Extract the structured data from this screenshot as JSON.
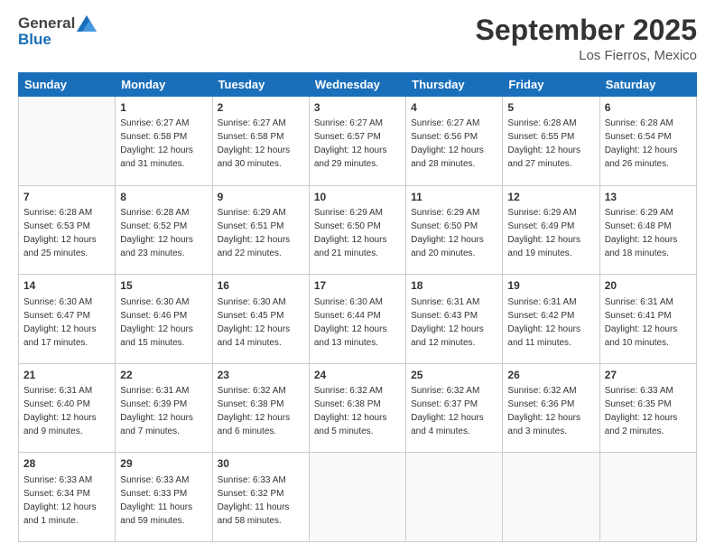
{
  "header": {
    "logo": {
      "general": "General",
      "blue": "Blue"
    },
    "title": "September 2025",
    "location": "Los Fierros, Mexico"
  },
  "calendar": {
    "days": [
      "Sunday",
      "Monday",
      "Tuesday",
      "Wednesday",
      "Thursday",
      "Friday",
      "Saturday"
    ],
    "rows": [
      [
        {
          "day": "",
          "info": ""
        },
        {
          "day": "1",
          "info": "Sunrise: 6:27 AM\nSunset: 6:58 PM\nDaylight: 12 hours\nand 31 minutes."
        },
        {
          "day": "2",
          "info": "Sunrise: 6:27 AM\nSunset: 6:58 PM\nDaylight: 12 hours\nand 30 minutes."
        },
        {
          "day": "3",
          "info": "Sunrise: 6:27 AM\nSunset: 6:57 PM\nDaylight: 12 hours\nand 29 minutes."
        },
        {
          "day": "4",
          "info": "Sunrise: 6:27 AM\nSunset: 6:56 PM\nDaylight: 12 hours\nand 28 minutes."
        },
        {
          "day": "5",
          "info": "Sunrise: 6:28 AM\nSunset: 6:55 PM\nDaylight: 12 hours\nand 27 minutes."
        },
        {
          "day": "6",
          "info": "Sunrise: 6:28 AM\nSunset: 6:54 PM\nDaylight: 12 hours\nand 26 minutes."
        }
      ],
      [
        {
          "day": "7",
          "info": "Sunrise: 6:28 AM\nSunset: 6:53 PM\nDaylight: 12 hours\nand 25 minutes."
        },
        {
          "day": "8",
          "info": "Sunrise: 6:28 AM\nSunset: 6:52 PM\nDaylight: 12 hours\nand 23 minutes."
        },
        {
          "day": "9",
          "info": "Sunrise: 6:29 AM\nSunset: 6:51 PM\nDaylight: 12 hours\nand 22 minutes."
        },
        {
          "day": "10",
          "info": "Sunrise: 6:29 AM\nSunset: 6:50 PM\nDaylight: 12 hours\nand 21 minutes."
        },
        {
          "day": "11",
          "info": "Sunrise: 6:29 AM\nSunset: 6:50 PM\nDaylight: 12 hours\nand 20 minutes."
        },
        {
          "day": "12",
          "info": "Sunrise: 6:29 AM\nSunset: 6:49 PM\nDaylight: 12 hours\nand 19 minutes."
        },
        {
          "day": "13",
          "info": "Sunrise: 6:29 AM\nSunset: 6:48 PM\nDaylight: 12 hours\nand 18 minutes."
        }
      ],
      [
        {
          "day": "14",
          "info": "Sunrise: 6:30 AM\nSunset: 6:47 PM\nDaylight: 12 hours\nand 17 minutes."
        },
        {
          "day": "15",
          "info": "Sunrise: 6:30 AM\nSunset: 6:46 PM\nDaylight: 12 hours\nand 15 minutes."
        },
        {
          "day": "16",
          "info": "Sunrise: 6:30 AM\nSunset: 6:45 PM\nDaylight: 12 hours\nand 14 minutes."
        },
        {
          "day": "17",
          "info": "Sunrise: 6:30 AM\nSunset: 6:44 PM\nDaylight: 12 hours\nand 13 minutes."
        },
        {
          "day": "18",
          "info": "Sunrise: 6:31 AM\nSunset: 6:43 PM\nDaylight: 12 hours\nand 12 minutes."
        },
        {
          "day": "19",
          "info": "Sunrise: 6:31 AM\nSunset: 6:42 PM\nDaylight: 12 hours\nand 11 minutes."
        },
        {
          "day": "20",
          "info": "Sunrise: 6:31 AM\nSunset: 6:41 PM\nDaylight: 12 hours\nand 10 minutes."
        }
      ],
      [
        {
          "day": "21",
          "info": "Sunrise: 6:31 AM\nSunset: 6:40 PM\nDaylight: 12 hours\nand 9 minutes."
        },
        {
          "day": "22",
          "info": "Sunrise: 6:31 AM\nSunset: 6:39 PM\nDaylight: 12 hours\nand 7 minutes."
        },
        {
          "day": "23",
          "info": "Sunrise: 6:32 AM\nSunset: 6:38 PM\nDaylight: 12 hours\nand 6 minutes."
        },
        {
          "day": "24",
          "info": "Sunrise: 6:32 AM\nSunset: 6:38 PM\nDaylight: 12 hours\nand 5 minutes."
        },
        {
          "day": "25",
          "info": "Sunrise: 6:32 AM\nSunset: 6:37 PM\nDaylight: 12 hours\nand 4 minutes."
        },
        {
          "day": "26",
          "info": "Sunrise: 6:32 AM\nSunset: 6:36 PM\nDaylight: 12 hours\nand 3 minutes."
        },
        {
          "day": "27",
          "info": "Sunrise: 6:33 AM\nSunset: 6:35 PM\nDaylight: 12 hours\nand 2 minutes."
        }
      ],
      [
        {
          "day": "28",
          "info": "Sunrise: 6:33 AM\nSunset: 6:34 PM\nDaylight: 12 hours\nand 1 minute."
        },
        {
          "day": "29",
          "info": "Sunrise: 6:33 AM\nSunset: 6:33 PM\nDaylight: 11 hours\nand 59 minutes."
        },
        {
          "day": "30",
          "info": "Sunrise: 6:33 AM\nSunset: 6:32 PM\nDaylight: 11 hours\nand 58 minutes."
        },
        {
          "day": "",
          "info": ""
        },
        {
          "day": "",
          "info": ""
        },
        {
          "day": "",
          "info": ""
        },
        {
          "day": "",
          "info": ""
        }
      ]
    ]
  }
}
